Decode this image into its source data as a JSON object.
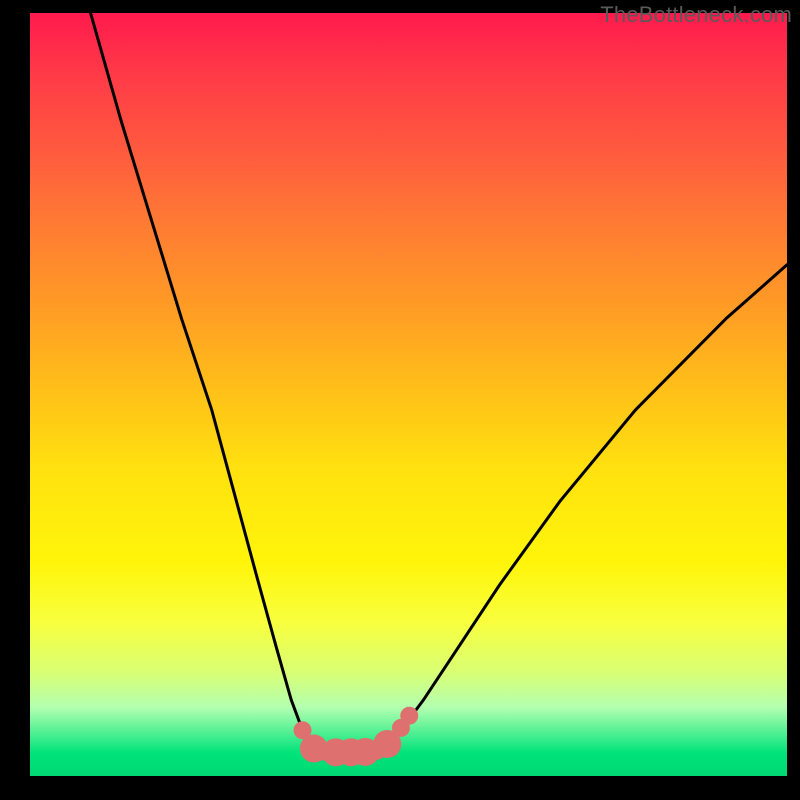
{
  "watermark": "TheBottleneck.com",
  "chart_data": {
    "type": "line",
    "title": "",
    "xlabel": "",
    "ylabel": "",
    "ylim": [
      0,
      100
    ],
    "xlim": [
      0,
      100
    ],
    "series": [
      {
        "name": "left-branch",
        "x": [
          8,
          12,
          16,
          20,
          24,
          27,
          30,
          32.5,
          34.5,
          36,
          37.4,
          38.3
        ],
        "values": [
          100,
          86,
          73,
          60,
          48,
          37,
          26,
          17,
          10,
          6,
          3.5,
          3.2
        ]
      },
      {
        "name": "right-branch",
        "x": [
          45.5,
          47,
          49,
          52,
          56,
          62,
          70,
          80,
          92,
          100
        ],
        "values": [
          3.2,
          3.8,
          6,
          10,
          16,
          25,
          36,
          48,
          60,
          67
        ]
      }
    ],
    "colors": {
      "curve": "#000000",
      "marker_fill": "#de716f",
      "marker_stroke": "#d05a58"
    },
    "markers": [
      {
        "x": 36.0,
        "y": 6.0,
        "r": 9
      },
      {
        "x": 37.5,
        "y": 3.6,
        "r": 14
      },
      {
        "x": 38.5,
        "y": 3.2,
        "r": 9
      },
      {
        "x": 40.4,
        "y": 3.1,
        "r": 14
      },
      {
        "x": 42.4,
        "y": 3.1,
        "r": 14
      },
      {
        "x": 44.3,
        "y": 3.15,
        "r": 14
      },
      {
        "x": 45.8,
        "y": 3.3,
        "r": 9
      },
      {
        "x": 47.2,
        "y": 4.2,
        "r": 14
      },
      {
        "x": 49.0,
        "y": 6.3,
        "r": 9
      },
      {
        "x": 50.1,
        "y": 7.9,
        "r": 9
      }
    ]
  }
}
